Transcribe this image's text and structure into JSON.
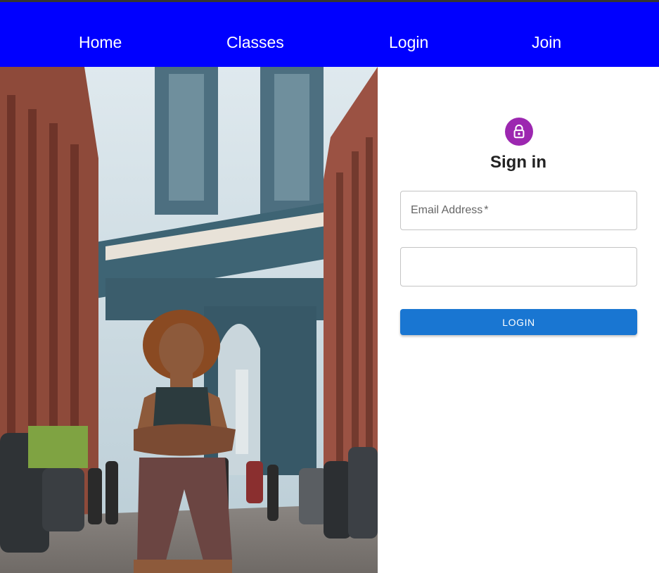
{
  "nav": {
    "items": [
      {
        "label": "Home"
      },
      {
        "label": "Classes"
      },
      {
        "label": "Login"
      },
      {
        "label": "Join"
      }
    ]
  },
  "colors": {
    "navbar": "#0000ff",
    "avatar": "#9c27b0",
    "primary_button": "#1976d2"
  },
  "hero": {
    "icon": "photo-city-street-bridge-fitness-woman"
  },
  "form": {
    "icon": "lock-icon",
    "title": "Sign in",
    "email": {
      "label": "Email Address",
      "required_mark": "*",
      "value": ""
    },
    "password": {
      "value": ""
    },
    "submit_label": "LOGIN"
  }
}
